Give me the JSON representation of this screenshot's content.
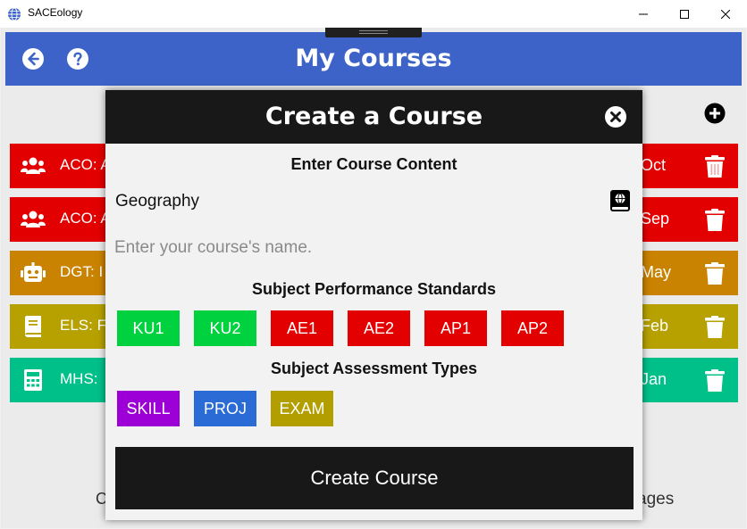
{
  "window": {
    "title": "SACEology",
    "icon": "globe-icon"
  },
  "header": {
    "title": "My Courses",
    "background": "#3d63c9"
  },
  "courses": [
    {
      "code": "ACO: A",
      "date": "Oct",
      "color": "#e30000",
      "icon": "users-icon"
    },
    {
      "code": "ACO: A",
      "date": "Sep",
      "color": "#e30000",
      "icon": "users-icon"
    },
    {
      "code": "DGT: I",
      "date": "May",
      "color": "#c98300",
      "icon": "robot-icon"
    },
    {
      "code": "ELS: F",
      "date": "Feb",
      "color": "#b6a100",
      "icon": "book-icon"
    },
    {
      "code": "MHS:",
      "date": "Jan",
      "color": "#00c08a",
      "icon": "calculator-icon"
    }
  ],
  "footer": {
    "left_text": "C",
    "right_text": "ages"
  },
  "modal": {
    "title": "Create a Course",
    "content_heading": "Enter Course Content",
    "subject_value": "Geography",
    "name_placeholder": "Enter your course's name.",
    "standards_heading": "Subject Performance Standards",
    "standards": [
      {
        "label": "KU1",
        "color": "#00d13f"
      },
      {
        "label": "KU2",
        "color": "#00d13f"
      },
      {
        "label": "AE1",
        "color": "#e30000"
      },
      {
        "label": "AE2",
        "color": "#e30000"
      },
      {
        "label": "AP1",
        "color": "#e30000"
      },
      {
        "label": "AP2",
        "color": "#e30000"
      }
    ],
    "assessment_heading": "Subject Assessment Types",
    "assessments": [
      {
        "label": "SKILL",
        "color": "#9c00d6"
      },
      {
        "label": "PROJ",
        "color": "#2b6bd6"
      },
      {
        "label": "EXAM",
        "color": "#b39e00"
      }
    ],
    "submit_label": "Create Course"
  }
}
